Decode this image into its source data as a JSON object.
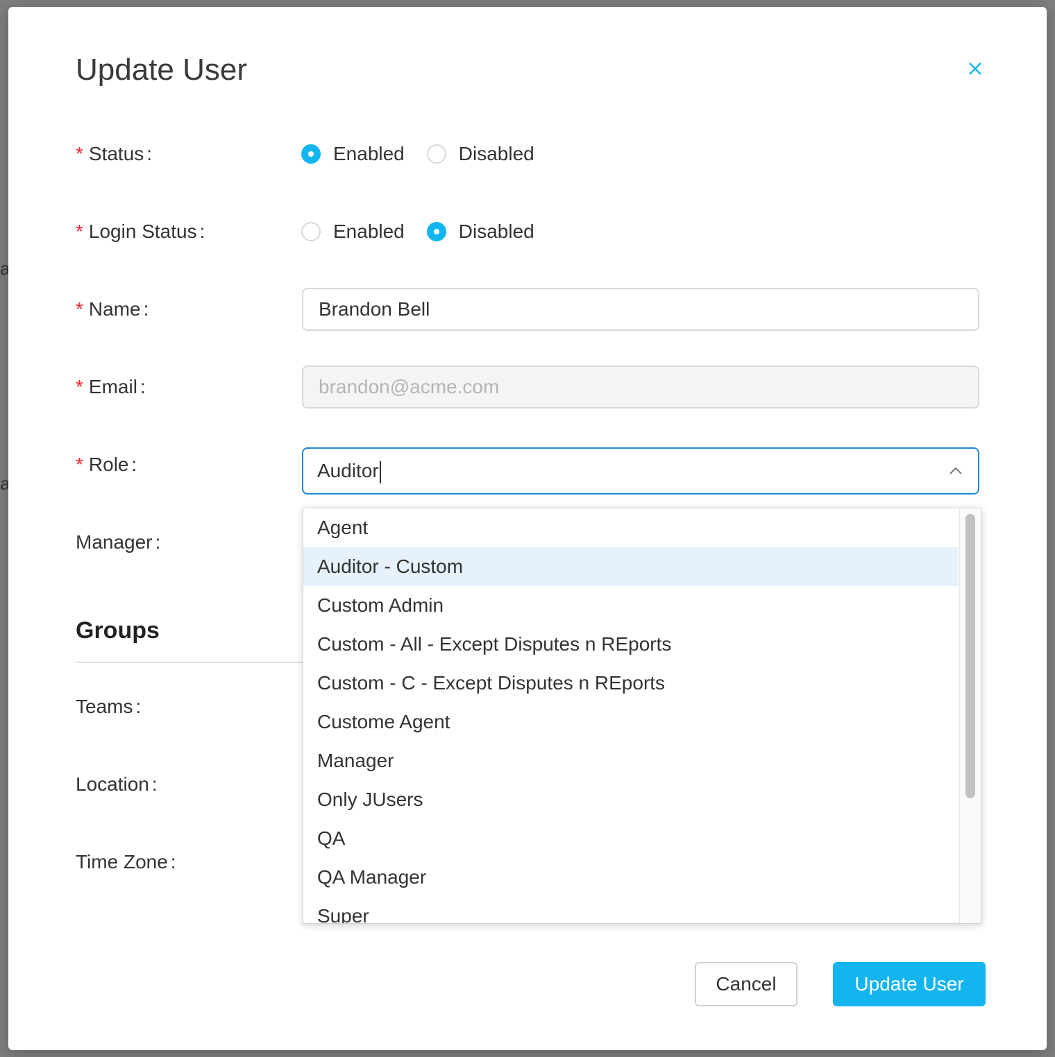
{
  "background": {
    "fragment_1": "ar",
    "fragment_2": "a"
  },
  "modal": {
    "title": "Update User",
    "close_icon": "close-icon"
  },
  "form": {
    "status": {
      "label": "Status",
      "options": [
        "Enabled",
        "Disabled"
      ],
      "selected": "Enabled"
    },
    "login_status": {
      "label": "Login Status",
      "options": [
        "Enabled",
        "Disabled"
      ],
      "selected": "Disabled"
    },
    "name": {
      "label": "Name",
      "value": "Brandon Bell"
    },
    "email": {
      "label": "Email",
      "value": "brandon@acme.com"
    },
    "role": {
      "label": "Role",
      "value": "Auditor"
    },
    "manager": {
      "label": "Manager"
    },
    "groups_title": "Groups",
    "teams": {
      "label": "Teams"
    },
    "location": {
      "label": "Location"
    },
    "time_zone": {
      "label": "Time Zone"
    },
    "colon": ":",
    "required_mark": "*"
  },
  "role_dropdown": {
    "items": [
      "Agent",
      "Auditor - Custom",
      "Custom Admin",
      "Custom - All - Except Disputes n REports",
      "Custom - C - Except Disputes n REports",
      "Custome Agent",
      "Manager",
      "Only JUsers",
      "QA",
      "QA Manager",
      "Super"
    ],
    "highlighted": "Auditor - Custom"
  },
  "buttons": {
    "cancel": "Cancel",
    "submit": "Update User"
  },
  "colors": {
    "accent": "#13b5f0",
    "focus_border": "#1e88d6",
    "required": "#f5222d",
    "highlight": "#e6f1fb"
  }
}
